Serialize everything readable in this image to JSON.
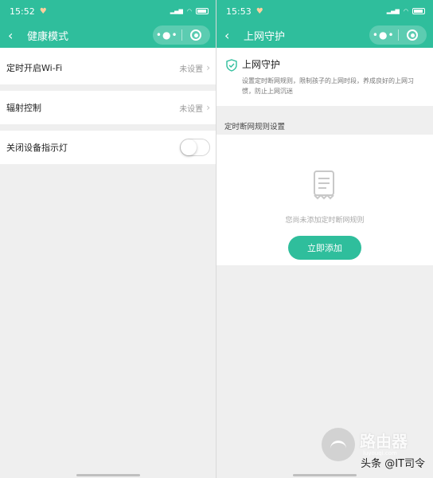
{
  "left": {
    "status": {
      "time": "15:52"
    },
    "nav": {
      "title": "健康模式"
    },
    "rows": [
      {
        "label": "定时开启Wi-Fi",
        "value": "未设置"
      },
      {
        "label": "辐射控制",
        "value": "未设置"
      }
    ],
    "indicator_row": {
      "label": "关闭设备指示灯",
      "toggle_on": false
    }
  },
  "right": {
    "status": {
      "time": "15:53"
    },
    "nav": {
      "title": "上网守护"
    },
    "guard": {
      "title": "上网守护",
      "desc": "设置定时断网规则，限制孩子的上网时段，养成良好的上网习惯，防止上网沉迷"
    },
    "section_label": "定时断网规则设置",
    "empty_text": "您尚未添加定时断网规则",
    "add_button": "立即添加"
  },
  "watermark": {
    "brand": "路由器",
    "sub": "luyouqi.com",
    "author": "头条 @IT司令"
  },
  "colors": {
    "accent": "#2fbe9c"
  }
}
